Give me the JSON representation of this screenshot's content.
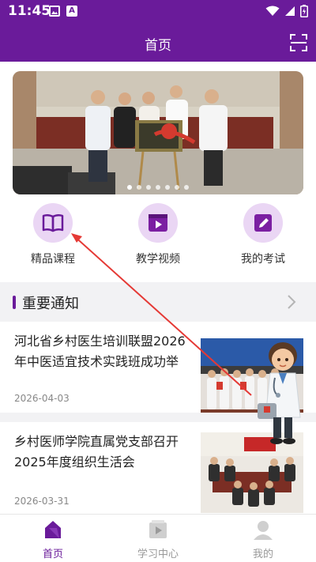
{
  "status_bar": {
    "time": "11:45"
  },
  "header": {
    "title": "首页"
  },
  "quick_menu": [
    {
      "label": "精品课程",
      "icon": "book-icon"
    },
    {
      "label": "教学视频",
      "icon": "video-play-icon"
    },
    {
      "label": "我的考试",
      "icon": "exam-edit-icon"
    }
  ],
  "notice": {
    "title": "重要通知"
  },
  "news": [
    {
      "title": "河北省乡村医生培训联盟2026年中医适宜技术实践班成功举",
      "date": "2026-04-03"
    },
    {
      "title": "乡村医师学院直属党支部召开2025年度组织生活会",
      "date": "2026-03-31"
    }
  ],
  "tabbar": [
    {
      "label": "首页",
      "icon": "home-icon",
      "active": true
    },
    {
      "label": "学习中心",
      "icon": "study-center-icon",
      "active": false
    },
    {
      "label": "我的",
      "icon": "profile-icon",
      "active": false
    }
  ],
  "banner": {
    "slide_count": 7,
    "active_index": 0
  },
  "colors": {
    "brand": "#6a1b9a",
    "icon_bg": "#ead6f4",
    "accent_arrow": "#e53935"
  }
}
